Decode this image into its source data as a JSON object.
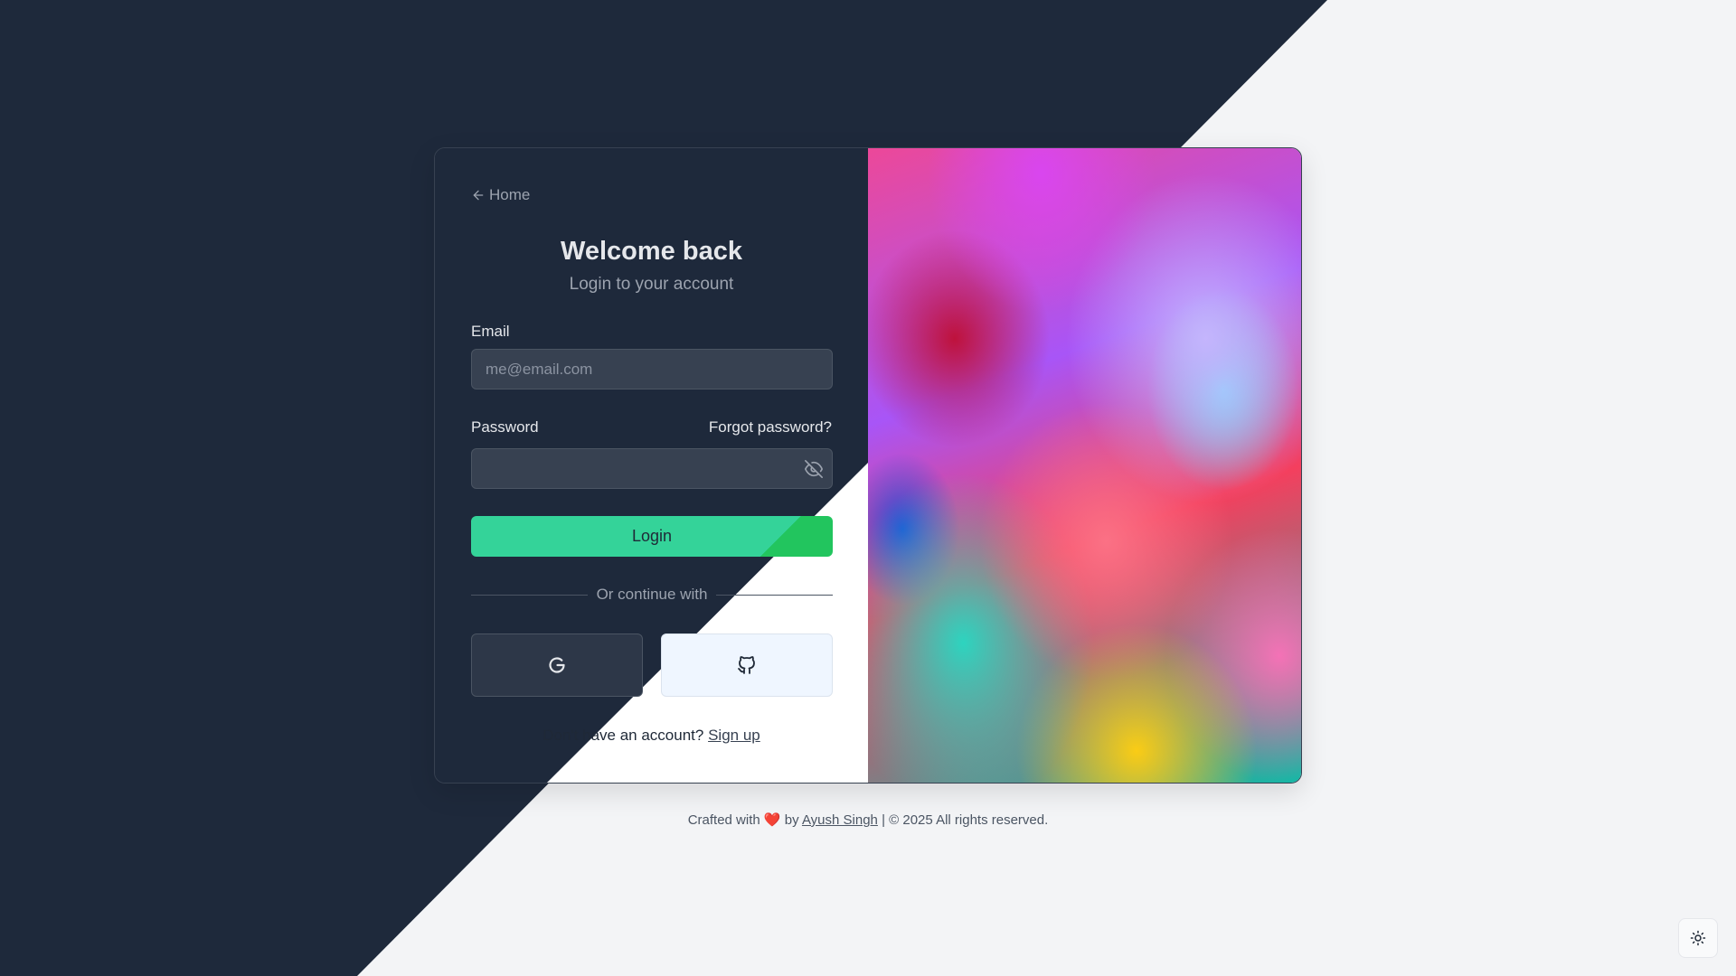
{
  "nav": {
    "home_label": "Home"
  },
  "header": {
    "title": "Welcome back",
    "subtitle": "Login to your account"
  },
  "form": {
    "email_label": "Email",
    "email_placeholder": "me@email.com",
    "email_value": "",
    "password_label": "Password",
    "forgot_label": "Forgot password?",
    "password_value": "",
    "login_label": "Login",
    "divider_text": "Or continue with"
  },
  "social": {
    "google_icon": "google-icon",
    "github_icon": "github-icon"
  },
  "signup": {
    "prompt": "Don't have an account?",
    "link_label": "Sign up"
  },
  "footer": {
    "crafted": "Crafted with",
    "heart": "❤️",
    "by": "by",
    "author": "Ayush Singh",
    "rights": "| © 2025 All rights reserved."
  },
  "icons": {
    "home": "arrow-left-icon",
    "password_toggle": "eye-off-icon",
    "theme_toggle": "sun-icon"
  },
  "colors": {
    "dark_bg": "#1e293b",
    "light_bg": "#f3f4f6",
    "accent": "#34d399",
    "accent_alt": "#22c55e"
  }
}
